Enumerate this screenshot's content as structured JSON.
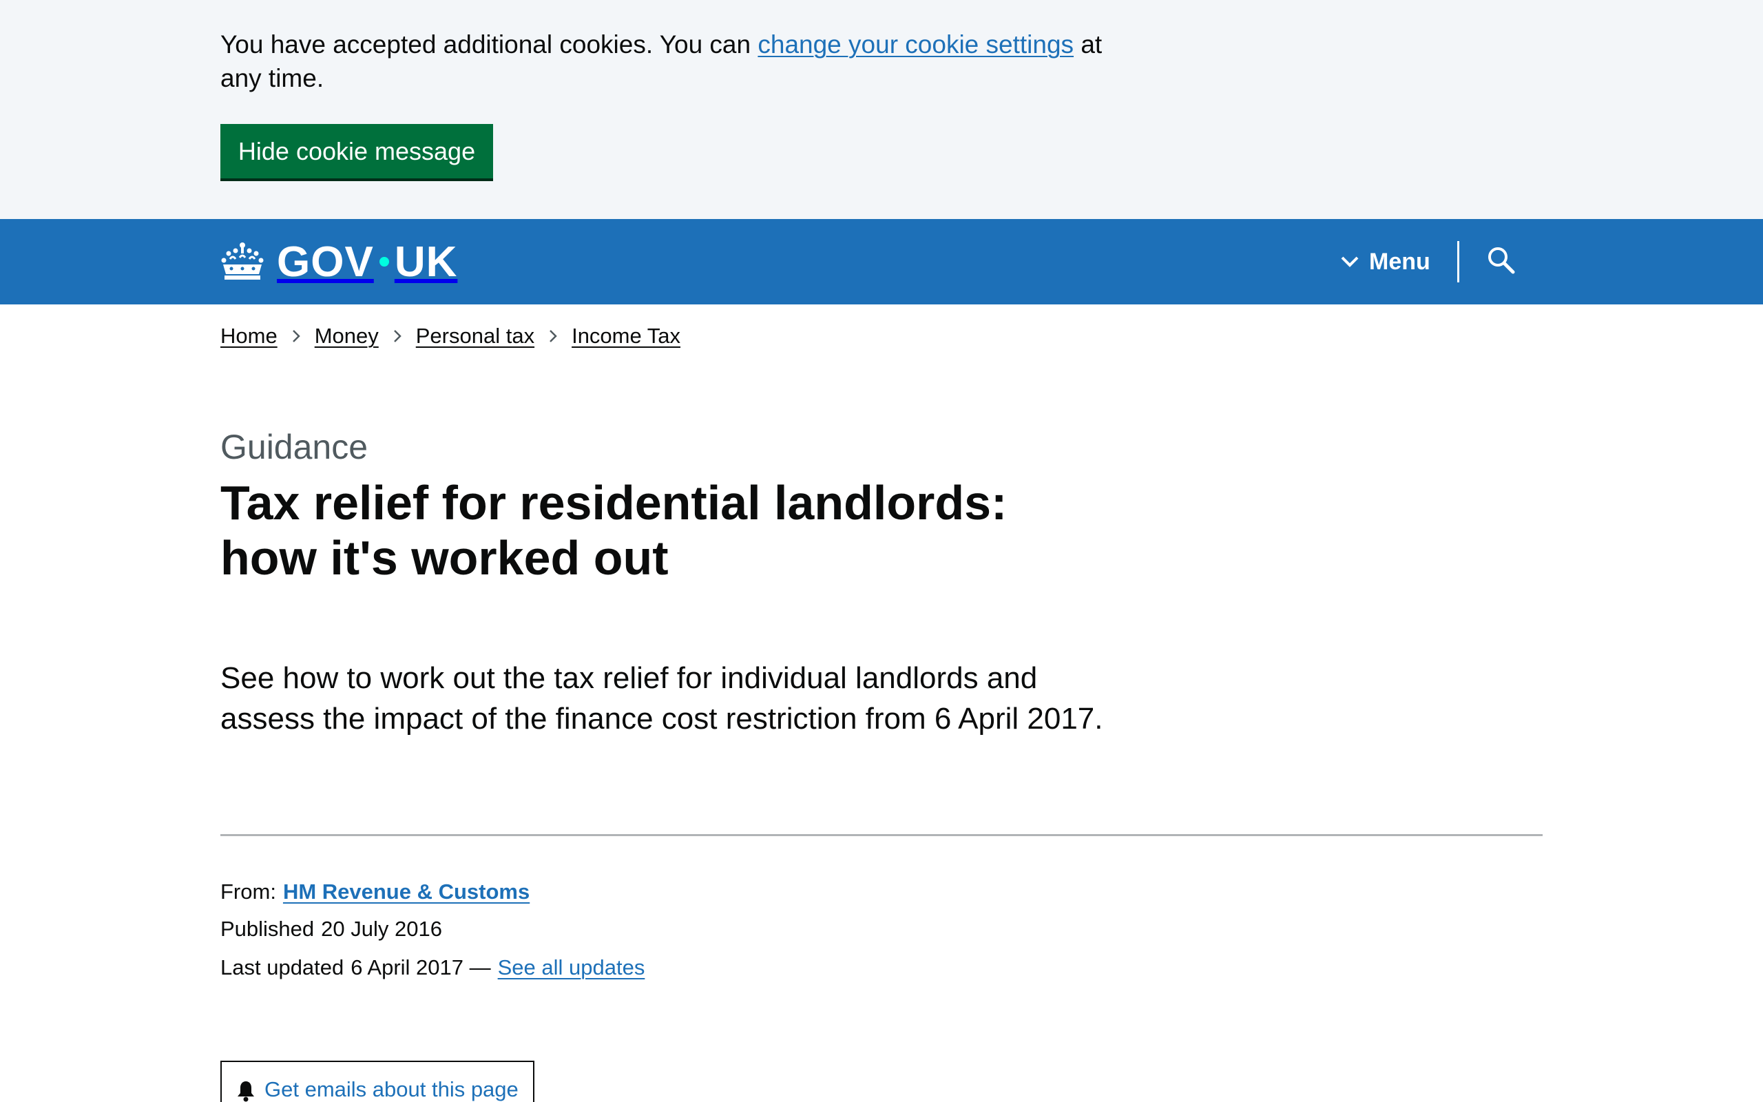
{
  "cookie_banner": {
    "text_before": "You have accepted additional cookies. You can ",
    "link_text": "change your cookie settings",
    "text_after": " at any time.",
    "hide_button": "Hide cookie message"
  },
  "header": {
    "logo_left": "GOV",
    "logo_right": "UK",
    "menu_label": "Menu",
    "search_icon": "search-icon",
    "background_color": "#1d70b8"
  },
  "breadcrumb": [
    "Home",
    "Money",
    "Personal tax",
    "Income Tax"
  ],
  "page": {
    "document_type": "Guidance",
    "title": "Tax relief for residential landlords: how it's worked out",
    "lead": "See how to work out the tax relief for individual landlords and assess the impact of the finance cost restriction from 6 April 2017."
  },
  "metadata": {
    "from_label": "From:",
    "from_org": "HM Revenue & Customs",
    "published_label": "Published",
    "published_date": "20 July 2016",
    "updated_label": "Last updated",
    "updated_date": "6 April 2017 —",
    "updates_link": "See all updates"
  },
  "email_button": {
    "label": "Get emails about this page",
    "icon": "bell-icon"
  },
  "colors": {
    "link": "#1d70b8",
    "button_green": "#00703c",
    "cookie_bg": "#f3f6f9",
    "secondary_text": "#505a5f"
  }
}
